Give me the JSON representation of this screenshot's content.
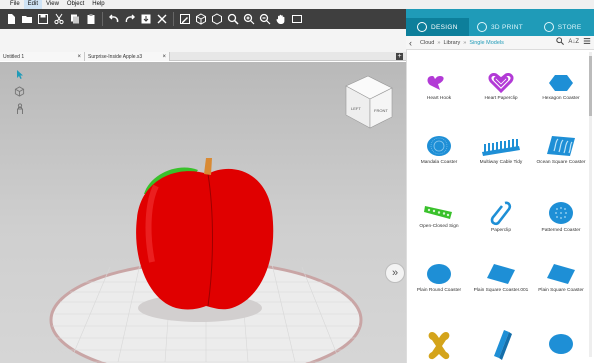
{
  "menu": [
    "File",
    "Edit",
    "View",
    "Object",
    "Help"
  ],
  "menu_active": "Edit",
  "panel_tabs": [
    {
      "label": "DESIGN",
      "icon": "design-icon",
      "active": true
    },
    {
      "label": "3D PRINT",
      "icon": "print-icon",
      "active": false
    },
    {
      "label": "STORE",
      "icon": "store-icon",
      "active": false
    }
  ],
  "doc_tabs": [
    "Untitled 1",
    "Surprise-Inside Apple.s3"
  ],
  "breadcrumb": [
    "Cloud",
    "Library",
    "Single Models"
  ],
  "view_cube": {
    "left": "LEFT",
    "front": "FRONT"
  },
  "library_items": [
    {
      "label": "Heart Hook",
      "icon": "heart-hook-icon"
    },
    {
      "label": "Heart Paperclip",
      "icon": "heart-paperclip-icon"
    },
    {
      "label": "Hexagon Coaster",
      "icon": "hexagon-coaster-icon"
    },
    {
      "label": "Mandala Coaster",
      "icon": "mandala-coaster-icon"
    },
    {
      "label": "Multiway Cable Tidy",
      "icon": "cable-tidy-icon"
    },
    {
      "label": "Ocean Square Coaster",
      "icon": "ocean-coaster-icon"
    },
    {
      "label": "Open-Closed Sign",
      "icon": "open-closed-sign-icon"
    },
    {
      "label": "Paperclip",
      "icon": "paperclip-icon"
    },
    {
      "label": "Patterned Coaster",
      "icon": "patterned-coaster-icon"
    },
    {
      "label": "Plain Round Coaster",
      "icon": "round-coaster-icon"
    },
    {
      "label": "Plain Square Coaster.001",
      "icon": "square-coaster-001-icon"
    },
    {
      "label": "Plain Square Coaster",
      "icon": "square-coaster-icon"
    },
    {
      "label": "",
      "icon": "bone-icon"
    },
    {
      "label": "",
      "icon": "clip-icon"
    },
    {
      "label": "",
      "icon": "round-coaster-2-icon"
    }
  ],
  "colors": {
    "accent": "#1f9bb8",
    "accent_dark": "#0d7f9b",
    "model_blue": "#1e8fd6",
    "model_purple": "#b23ad6",
    "apple_red": "#e00000",
    "leaf_green": "#39c12b",
    "stem": "#d98a34",
    "toolbar": "#3f3f3f"
  }
}
